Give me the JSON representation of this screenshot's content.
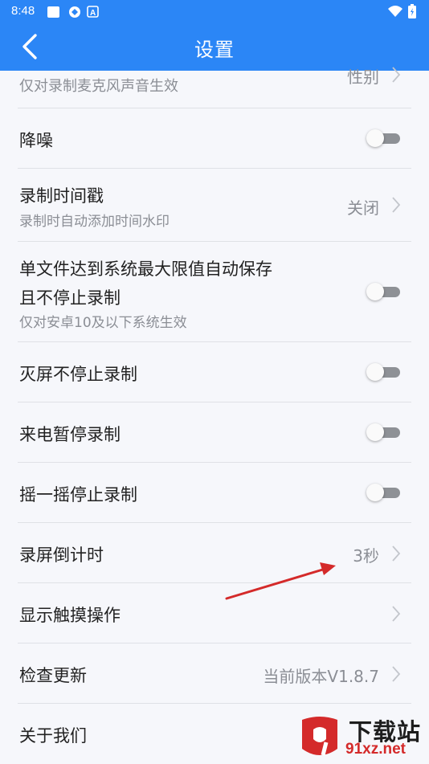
{
  "status_bar": {
    "time": "8:48"
  },
  "header": {
    "title": "设置"
  },
  "settings": {
    "partial_sub": "仅对录制麦克风声音生效",
    "partial_value": "性别",
    "noise_reduction": {
      "title": "降噪",
      "enabled": false
    },
    "timestamp": {
      "title": "录制时间戳",
      "subtitle": "录制时自动添加时间水印",
      "value": "关闭"
    },
    "auto_save": {
      "title_line1": "单文件达到系统最大限值自动保存",
      "title_line2": "且不停止录制",
      "subtitle": "仅对安卓10及以下系统生效",
      "enabled": false
    },
    "screen_off": {
      "title": "灭屏不停止录制",
      "enabled": false
    },
    "incoming_call": {
      "title": "来电暂停录制",
      "enabled": false
    },
    "shake_stop": {
      "title": "摇一摇停止录制",
      "enabled": false
    },
    "countdown": {
      "title": "录屏倒计时",
      "value": "3秒"
    },
    "show_touch": {
      "title": "显示触摸操作"
    },
    "check_update": {
      "title": "检查更新",
      "value": "当前版本V1.8.7"
    },
    "about": {
      "title": "关于我们"
    }
  },
  "watermark": {
    "text": "下载站",
    "url": "91xz.net"
  },
  "colors": {
    "accent": "#2b86f6",
    "arrow": "#d42a2a",
    "toggle_off": "#8e9196"
  }
}
